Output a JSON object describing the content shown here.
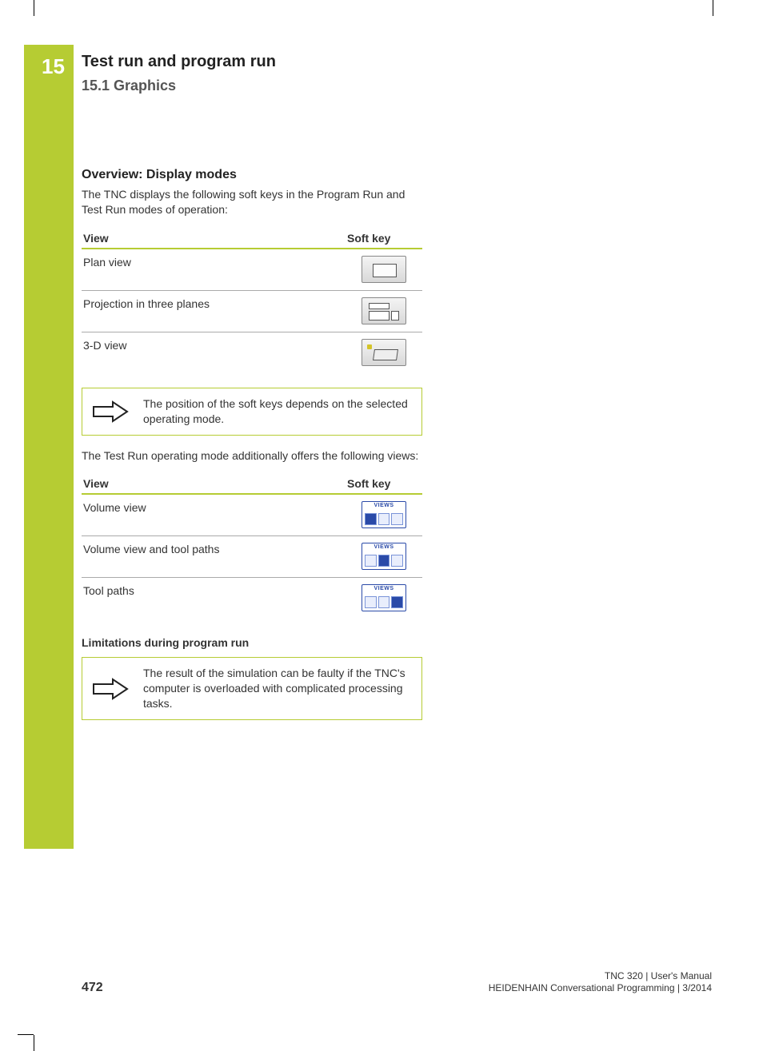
{
  "chapter_number": "15",
  "chapter_title": "Test run and program run",
  "section_title": "15.1   Graphics",
  "overview": {
    "heading": "Overview: Display modes",
    "intro": "The TNC displays the following soft keys in the Program Run and Test Run modes of operation:",
    "table1": {
      "col_view": "View",
      "col_softkey": "Soft key",
      "rows": [
        {
          "view": "Plan view",
          "icon": "plan-view-icon"
        },
        {
          "view": "Projection in three planes",
          "icon": "projection-three-planes-icon"
        },
        {
          "view": "3-D view",
          "icon": "3d-view-icon"
        }
      ]
    },
    "hint1": "The position of the soft keys depends on the selected operating mode.",
    "testrun_intro": "The Test Run operating mode additionally offers the following views:",
    "table2": {
      "col_view": "View",
      "col_softkey": "Soft key",
      "views_label": "VIEWS",
      "rows": [
        {
          "view": "Volume view",
          "icon": "views-volume-icon"
        },
        {
          "view": "Volume view and tool paths",
          "icon": "views-volume-toolpaths-icon"
        },
        {
          "view": "Tool paths",
          "icon": "views-toolpaths-icon"
        }
      ]
    },
    "limitations_heading": "Limitations during program run",
    "hint2": "The result of the simulation can be faulty if the TNC's computer is overloaded with complicated processing tasks."
  },
  "footer": {
    "page": "472",
    "meta_line1": "TNC 320 | User's Manual",
    "meta_line2": "HEIDENHAIN Conversational Programming | 3/2014"
  }
}
